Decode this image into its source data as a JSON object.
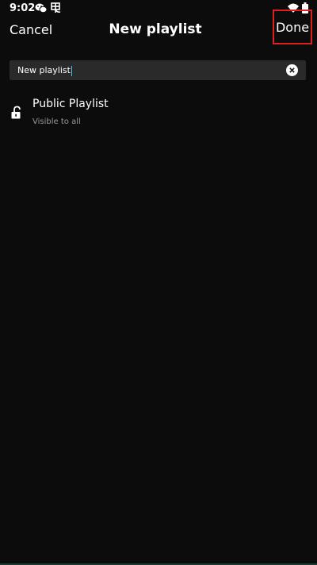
{
  "status_bar": {
    "time": "9:02",
    "icons": [
      "wechat-icon",
      "app-notification-icon",
      "wifi-icon",
      "battery-icon"
    ]
  },
  "header": {
    "cancel_label": "Cancel",
    "title": "New playlist",
    "done_label": "Done",
    "done_highlight_color": "#e0201f"
  },
  "name_field": {
    "value": "New playlist",
    "clear_icon": "clear-icon"
  },
  "visibility_option": {
    "title": "Public Playlist",
    "subtitle": "Visible to all",
    "icon": "unlock-icon"
  },
  "colors": {
    "background": "#0c0c0c",
    "input_background": "#2a2a2a",
    "caret": "#4ec3e0",
    "subtitle_text": "#9a9a9a"
  }
}
